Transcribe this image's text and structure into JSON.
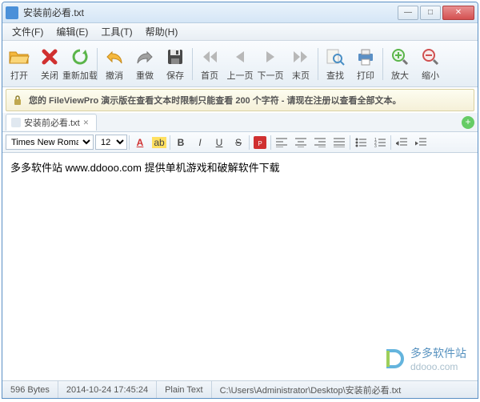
{
  "window": {
    "title": "安装前必看.txt"
  },
  "menu": {
    "file": "文件(F)",
    "edit": "编辑(E)",
    "tools": "工具(T)",
    "help": "帮助(H)"
  },
  "toolbar": {
    "open": "打开",
    "close": "关闭",
    "reload": "重新加载",
    "undo": "撤消",
    "redo": "重做",
    "save": "保存",
    "first": "首页",
    "prev": "上一页",
    "next": "下一页",
    "last": "末页",
    "find": "查找",
    "print": "打印",
    "zoomin": "放大",
    "zoomout": "缩小"
  },
  "banner": {
    "text": "您的 FileViewPro 演示版在查看文本时限制只能查看 200 个字符 - 请现在注册以查看全部文本。"
  },
  "tabs": [
    {
      "label": "安装前必看.txt"
    }
  ],
  "format": {
    "font": "Times New Roman",
    "size": "12"
  },
  "document": {
    "line1": "多多软件站 www.ddooo.com 提供单机游戏和破解软件下载"
  },
  "status": {
    "size": "596 Bytes",
    "datetime": "2014-10-24  17:45:24",
    "mode": "Plain Text",
    "path": "C:\\Users\\Administrator\\Desktop\\安装前必看.txt"
  },
  "watermark": {
    "cn": "多多软件站",
    "en": "ddooo.com"
  }
}
